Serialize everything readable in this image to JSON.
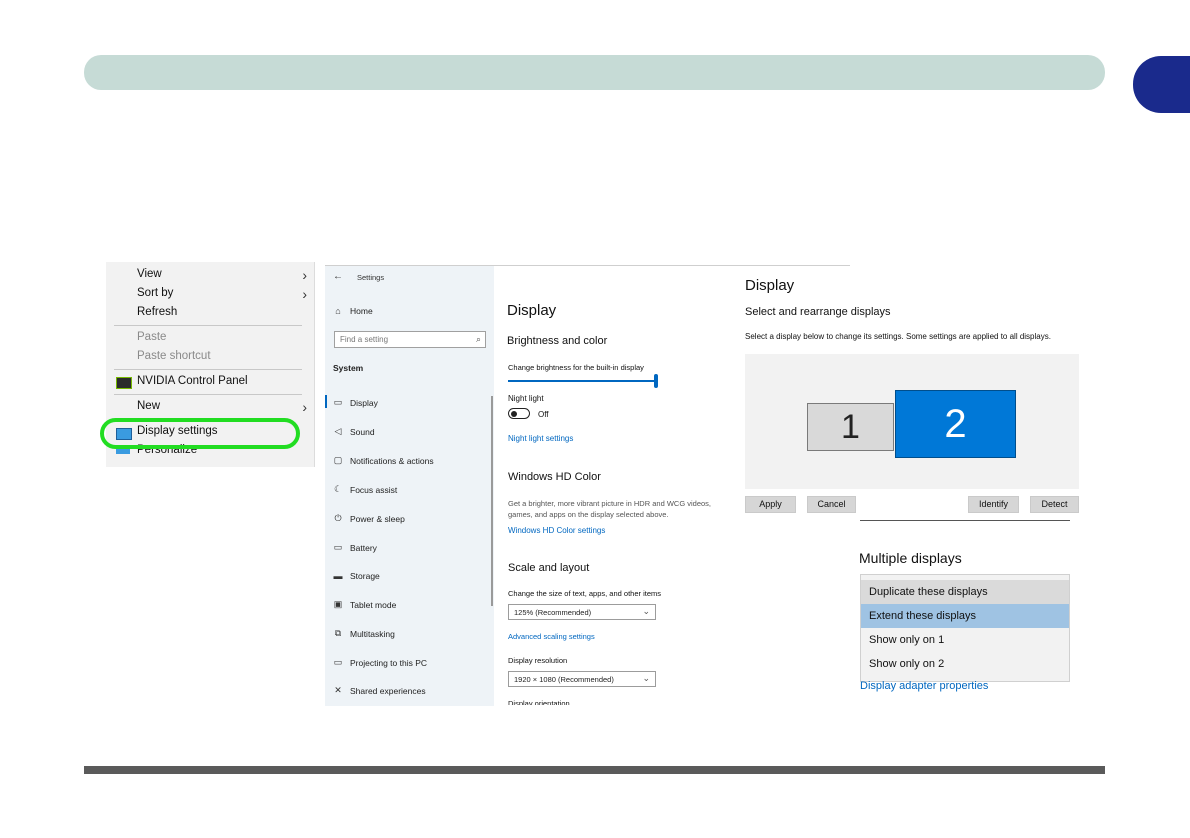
{
  "context_menu": {
    "items": [
      {
        "label": "View",
        "disabled": false,
        "submenu": true
      },
      {
        "label": "Sort by",
        "disabled": false,
        "submenu": true
      },
      {
        "label": "Refresh",
        "disabled": false,
        "submenu": false
      },
      {
        "label": "Paste",
        "disabled": true,
        "submenu": false
      },
      {
        "label": "Paste shortcut",
        "disabled": true,
        "submenu": false
      },
      {
        "label": "NVIDIA Control Panel",
        "disabled": false,
        "submenu": false,
        "icon": "nvidia-icon"
      },
      {
        "label": "New",
        "disabled": false,
        "submenu": true
      },
      {
        "label": "Display settings",
        "disabled": false,
        "submenu": false,
        "icon": "monitor-icon",
        "highlighted": true
      },
      {
        "label": "Personalize",
        "disabled": false,
        "submenu": false,
        "icon": "personalize-icon"
      }
    ]
  },
  "settings": {
    "back_icon": "back-arrow-icon",
    "title": "Settings",
    "home_label": "Home",
    "search_placeholder": "Find a setting",
    "section_label": "System",
    "nav": [
      {
        "label": "Display",
        "icon": "monitor-icon",
        "selected": true
      },
      {
        "label": "Sound",
        "icon": "speaker-icon"
      },
      {
        "label": "Notifications & actions",
        "icon": "notification-icon"
      },
      {
        "label": "Focus assist",
        "icon": "moon-icon"
      },
      {
        "label": "Power & sleep",
        "icon": "power-icon"
      },
      {
        "label": "Battery",
        "icon": "battery-icon"
      },
      {
        "label": "Storage",
        "icon": "storage-icon"
      },
      {
        "label": "Tablet mode",
        "icon": "tablet-icon"
      },
      {
        "label": "Multitasking",
        "icon": "multitask-icon"
      },
      {
        "label": "Projecting to this PC",
        "icon": "projector-icon"
      },
      {
        "label": "Shared experiences",
        "icon": "share-icon"
      }
    ],
    "content": {
      "heading": "Display",
      "brightness_heading": "Brightness and color",
      "brightness_label": "Change brightness for the built-in display",
      "brightness_value": 0.99,
      "night_light_label": "Night light",
      "night_light_state": "Off",
      "night_light_link": "Night light settings",
      "hdr_heading": "Windows HD Color",
      "hdr_desc": "Get a brighter, more vibrant picture in HDR and WCG videos, games, and apps on the display selected above.",
      "hdr_link": "Windows HD Color settings",
      "scale_heading": "Scale and layout",
      "scale_label": "Change the size of text, apps, and other items",
      "scale_value": "125% (Recommended)",
      "advanced_scaling_link": "Advanced scaling settings",
      "resolution_label": "Display resolution",
      "resolution_value": "1920 × 1080 (Recommended)",
      "orientation_label": "Display orientation"
    }
  },
  "arrange": {
    "heading": "Display",
    "subheading": "Select and rearrange displays",
    "hint": "Select a display below to change its settings. Some settings are applied to all displays.",
    "monitor_1": "1",
    "monitor_2": "2",
    "buttons": {
      "apply": "Apply",
      "cancel": "Cancel",
      "identify": "Identify",
      "detect": "Detect"
    }
  },
  "multiple_displays": {
    "heading": "Multiple displays",
    "options": [
      {
        "label": "Duplicate these displays",
        "state": "hover"
      },
      {
        "label": "Extend these displays",
        "state": "selected"
      },
      {
        "label": "Show only on 1",
        "state": "normal"
      },
      {
        "label": "Show only on 2",
        "state": "normal"
      }
    ],
    "adapter_link": "Display adapter properties"
  },
  "colors": {
    "accent": "#0067c0",
    "monitor_selected": "#0078d7",
    "highlight_ring": "#22dd22",
    "chapter_tab": "#1a2a8c",
    "header_bar": "#c6dbd6"
  }
}
